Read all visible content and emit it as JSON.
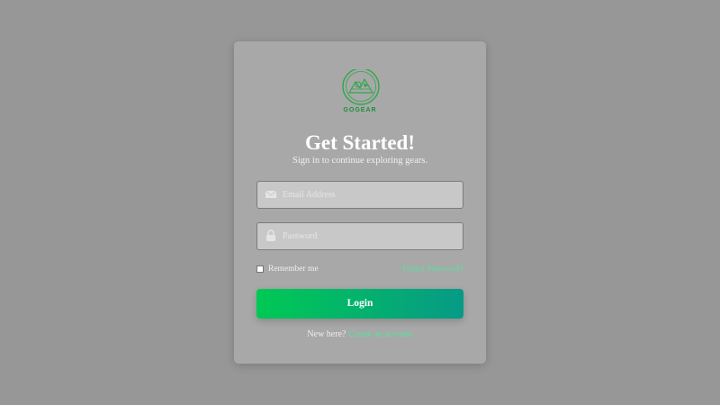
{
  "brand": {
    "name": "GOGEAR",
    "logo_icon": "gear-mountain-logo",
    "color": "#1e8f3a"
  },
  "heading": {
    "title": "Get Started!",
    "subtitle": "Sign in to continue exploring gears."
  },
  "form": {
    "email": {
      "icon": "envelope-icon",
      "placeholder": "Email Address",
      "value": ""
    },
    "password": {
      "icon": "lock-icon",
      "placeholder": "Password",
      "value": ""
    },
    "remember_label": "Remember me",
    "remember_checked": false,
    "forgot_label": "Forgot Password?",
    "login_label": "Login"
  },
  "footer": {
    "prompt": "New here?",
    "signup_label": "Create an account"
  },
  "colors": {
    "page_bg": "#979797",
    "card_bg": "#a8a8a8",
    "accent": "#57e39a",
    "button_start": "#00c954",
    "button_end": "#079a86"
  }
}
